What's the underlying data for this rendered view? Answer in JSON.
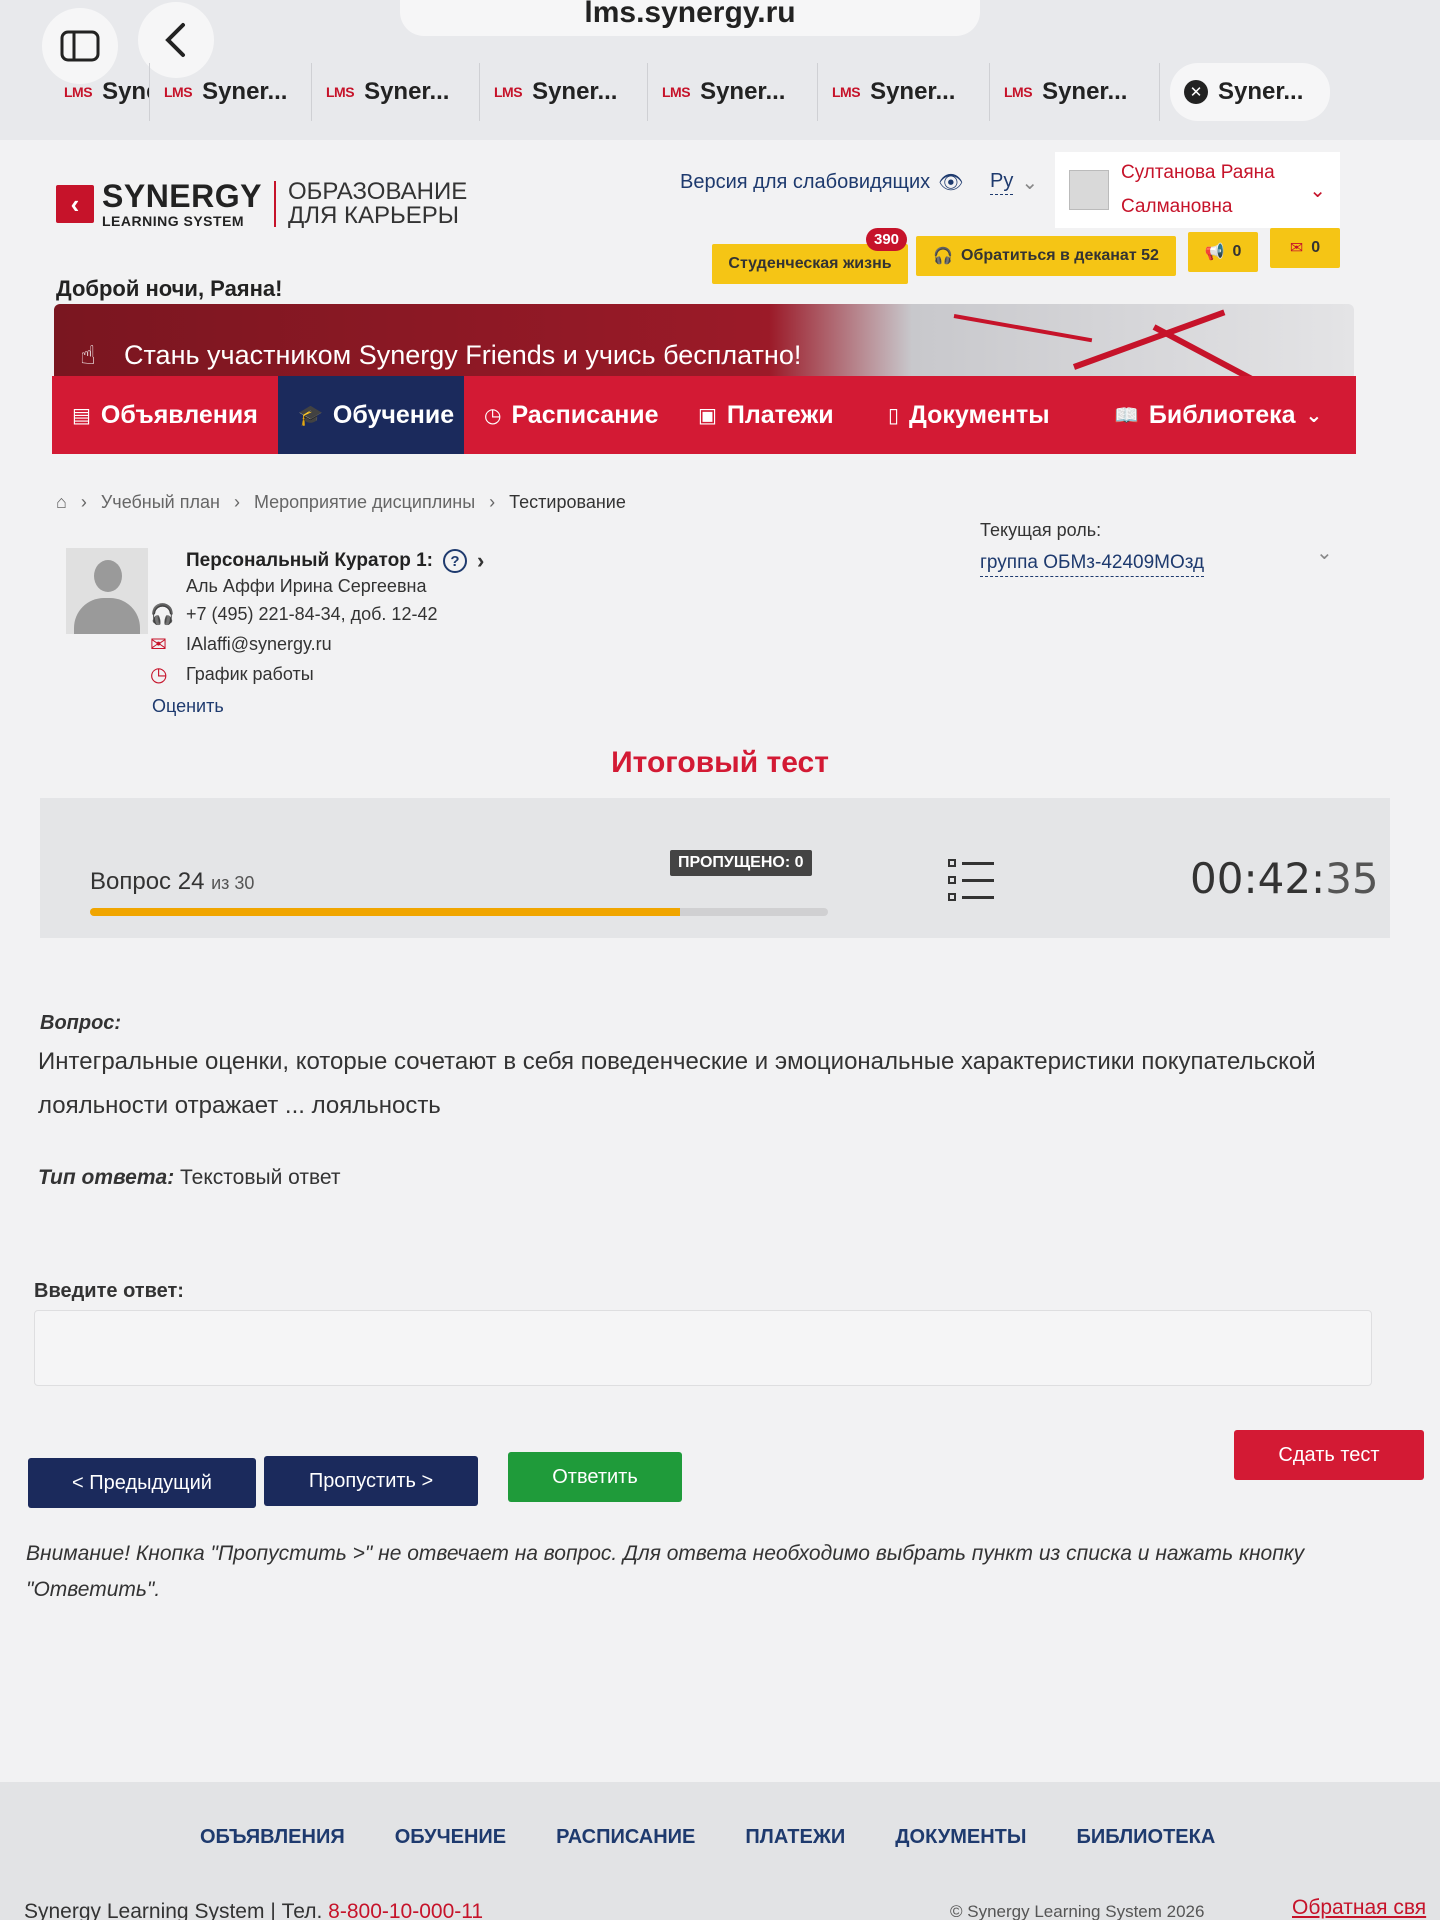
{
  "browser": {
    "url": "lms.synergy.ru",
    "tabs": [
      "Synei",
      "Syner...",
      "Syner...",
      "Syner...",
      "Syner...",
      "Syner...",
      "Syner...",
      "Syner..."
    ],
    "tab_icon": "LMS"
  },
  "header": {
    "logo_name": "SYNERGY",
    "logo_sub": "LEARNING SYSTEM",
    "logo_tag_1": "ОБРАЗОВАНИЕ",
    "logo_tag_2": "ДЛЯ КАРЬЕРЫ",
    "vision_link": "Версия для слабовидящих",
    "language": "Ру",
    "user_name_1": "Султанова Раяна",
    "user_name_2": "Салмановна",
    "student_life": "Студенческая жизнь",
    "student_life_badge": "390",
    "deanery": "Обратиться в деканат 52",
    "announcements_count": "0",
    "messages_count": "0",
    "greeting": "Доброй ночи, Раяна!"
  },
  "promo": {
    "text": "Стань участником Synergy Friends и учись бесплатно!"
  },
  "nav": {
    "items": [
      "Объявления",
      "Обучение",
      "Расписание",
      "Платежи",
      "Документы",
      "Библиотека"
    ],
    "active": "Обучение"
  },
  "breadcrumb": [
    "Учебный план",
    "Мероприятие дисциплины",
    "Тестирование"
  ],
  "curator": {
    "title": "Персональный Куратор 1:",
    "name": "Аль Аффи Ирина Сергеевна",
    "phone": "+7 (495) 221-84-34, доб. 12-42",
    "email": "IAlaffi@synergy.ru",
    "schedule": "График работы",
    "rate": "Оценить"
  },
  "role": {
    "label": "Текущая роль:",
    "value": "группа ОБМз-42409МОзд"
  },
  "test": {
    "title": "Итоговый тест",
    "question_label": "Вопрос",
    "question_number": "24",
    "of_label": "из 30",
    "progress_fraction": 0.8,
    "skipped": "ПРОПУЩЕНО: 0",
    "timer_hm": "00:42:",
    "timer_s": "35",
    "q_heading": "Вопрос:",
    "q_text": "Интегральные оценки, которые сочетают в себя поведенческие и эмоциональные характеристики покупательской лояльности отражает ... лояльность",
    "answer_type_label": "Тип ответа:",
    "answer_type_value": " Текстовый ответ",
    "enter_label": "Введите ответ:",
    "answer_value": "",
    "btn_prev": "< Предыдущий",
    "btn_skip": "Пропустить >",
    "btn_answer": "Ответить",
    "btn_submit": "Сдать тест",
    "warning": "Внимание! Кнопка \"Пропустить >\" не отвечает на вопрос. Для ответа необходимо выбрать пункт из списка и нажать кнопку \"Ответить\"."
  },
  "footer": {
    "nav": [
      "ОБЪЯВЛЕНИЯ",
      "ОБУЧЕНИЕ",
      "РАСПИСАНИЕ",
      "ПЛАТЕЖИ",
      "ДОКУМЕНТЫ",
      "БИБЛИОТЕКА"
    ],
    "brand": "Synergy Learning System",
    "phone_label": "Тел.",
    "phone": "8-800-10-000-11",
    "copyright": "© Synergy Learning System 2026",
    "feedback": "Обратная свя"
  },
  "colors": {
    "brand_red": "#d31a34",
    "navy": "#1b2a5c",
    "green": "#1f9b3a",
    "yellow": "#f5c515",
    "progress": "#f0a500"
  }
}
